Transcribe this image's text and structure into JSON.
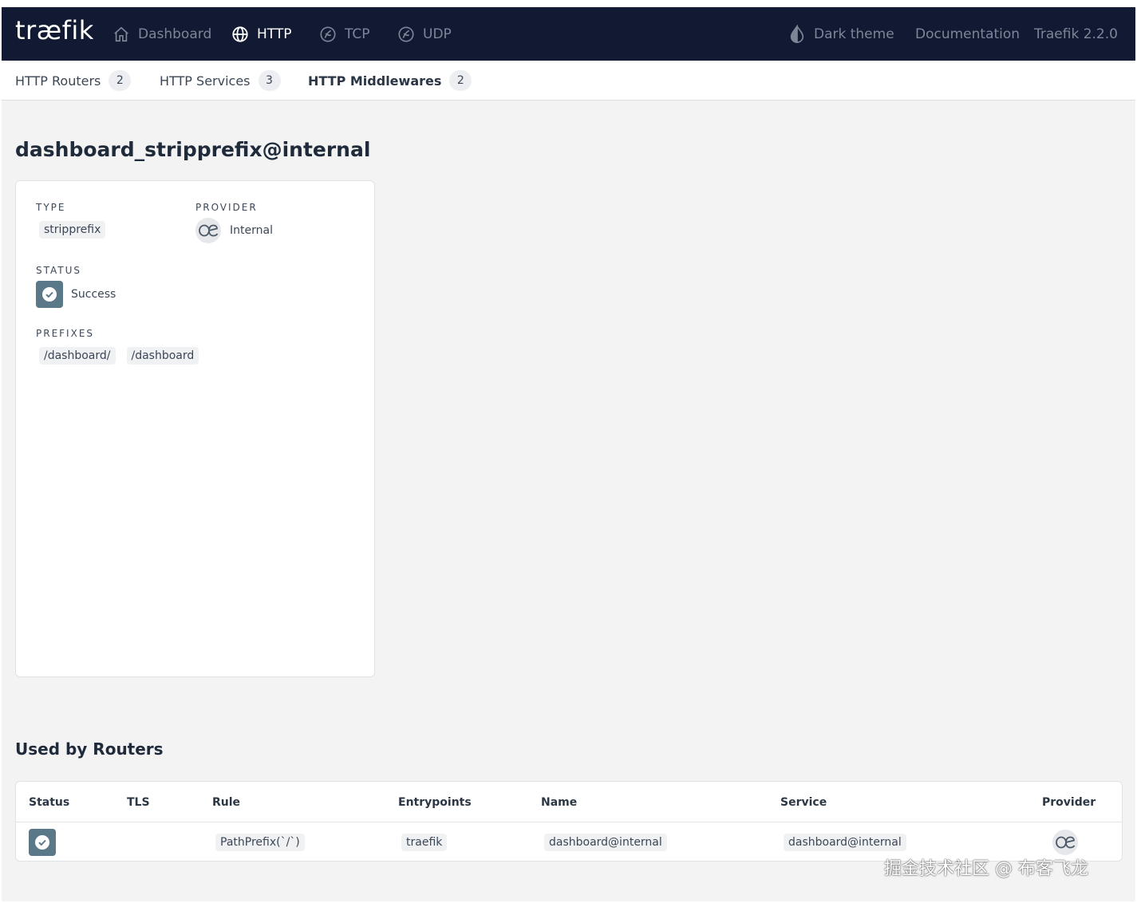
{
  "brand": {
    "logo_text": "træfik"
  },
  "topnav": {
    "dashboard": "Dashboard",
    "http": "HTTP",
    "tcp": "TCP",
    "udp": "UDP",
    "dark_theme": "Dark theme",
    "documentation": "Documentation",
    "version": "Traefik 2.2.0"
  },
  "subnav": {
    "routers": {
      "label": "HTTP Routers",
      "count": "2"
    },
    "services": {
      "label": "HTTP Services",
      "count": "3"
    },
    "middlewares": {
      "label": "HTTP Middlewares",
      "count": "2"
    }
  },
  "page": {
    "title": "dashboard_stripprefix@internal"
  },
  "details": {
    "type_label": "TYPE",
    "type_value": "stripprefix",
    "provider_label": "PROVIDER",
    "provider_value": "Internal",
    "status_label": "STATUS",
    "status_value": "Success",
    "prefixes_label": "PREFIXES",
    "prefixes": [
      "/dashboard/",
      "/dashboard"
    ]
  },
  "routers": {
    "title": "Used by Routers",
    "columns": [
      "Status",
      "TLS",
      "Rule",
      "Entrypoints",
      "Name",
      "Service",
      "Provider"
    ],
    "rows": [
      {
        "rule": "PathPrefix(`/`)",
        "entrypoints": "traefik",
        "name": "dashboard@internal",
        "service": "dashboard@internal"
      }
    ]
  },
  "watermark": "掘金技术社区 @ 布客飞龙",
  "colors": {
    "nav_bg": "#121a33",
    "page_bg": "#f3f3f4",
    "status_success": "#5b7889"
  }
}
